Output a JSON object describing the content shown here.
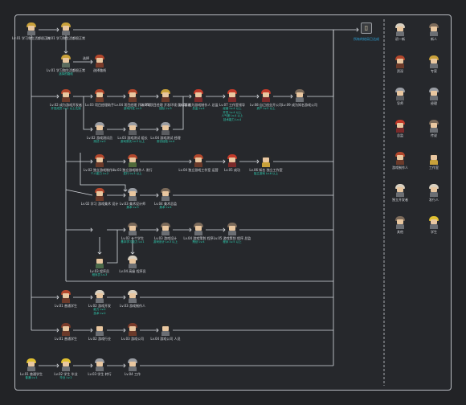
{
  "colors": {
    "line": "#d8dbe0",
    "accent": "#2fd0b3",
    "divider": "#c9cbd0",
    "end_label": "#2aa7e0"
  },
  "end_node": {
    "icon": "doorway-icon",
    "label": "所有的结局已达成"
  },
  "edge_note": "选择",
  "nodes": [
    {
      "id": "n1",
      "label": "Lv.01 学习和生活都很正常",
      "sub": "",
      "hair": "#c9a13a",
      "body": "#6b6e73"
    },
    {
      "id": "n2",
      "label": "Lv.01 学习和生活都很正常",
      "sub": "",
      "hair": "#c9a13a",
      "body": "#6b6e73"
    },
    {
      "id": "n3",
      "label": "Lv.01 学习和生活都很正常",
      "sub": "选择的路线",
      "hair": "#c9a13a",
      "body": "#5b6b5e"
    },
    {
      "id": "n4",
      "label": "选择路线",
      "sub": "",
      "hair": "#b3472c",
      "body": "#7a3b2a"
    },
    {
      "id": "n5",
      "label": "Lv.02 成为游戏开发者",
      "sub": "开发成员 Lv.2 以上达到",
      "hair": "#b3472c",
      "body": "#6b3a2a"
    },
    {
      "id": "n6",
      "label": "Lv.03 项目经理助手",
      "sub": "",
      "hair": "#b3472c",
      "body": "#6b3a2a"
    },
    {
      "id": "n7",
      "label": "Lv.04 项目经理 开发环境",
      "sub": "游戏开发 Lv.3",
      "hair": "#b3472c",
      "body": "#6b3a2a"
    },
    {
      "id": "n8",
      "label": "Lv.05 项目经理 开发环境 团队管理",
      "sub": "团队 Lv.3",
      "hair": "#c9a13a",
      "body": "#6b3a2a"
    },
    {
      "id": "n9",
      "label": "Lv.06 成为游戏制作人 总监",
      "sub": "总监 Lv.4",
      "hair": "#c23a2a",
      "body": "#7a2a2a"
    },
    {
      "id": "n10",
      "label": "Lv.07 工作室领导",
      "sub": "经营 Lv.4 以上\n开发 Lv.4 以上\n人气度 Lv.4 以上\n技术能力 Lv.4",
      "hair": "#c23a2a",
      "body": "#7a2a2a"
    },
    {
      "id": "n11",
      "label": "Lv.08 自己创业开公司",
      "sub": "资产 Lv.5 以上",
      "hair": "#c23a2a",
      "body": "#7a2a2a"
    },
    {
      "id": "n12",
      "label": "Lv.09 成为知名游戏公司",
      "sub": "",
      "hair": "#7b6a5a",
      "body": "#6b6e73"
    },
    {
      "id": "n13",
      "label": "Lv.02 游戏测试员",
      "sub": "测试 Lv.2",
      "hair": "#9a9da3",
      "body": "#5a5c60"
    },
    {
      "id": "n14",
      "label": "Lv.03 游戏测试 组长",
      "sub": "游戏测试 Lv.3 以上",
      "hair": "#9a9da3",
      "body": "#5a5c60"
    },
    {
      "id": "n15",
      "label": "Lv.04 游戏测试 经理",
      "sub": "测试经验 Lv.4",
      "hair": "#9a9da3",
      "body": "#5a5c60"
    },
    {
      "id": "n16",
      "label": "Lv.02 独立游戏制作人",
      "sub": "个人能力 Lv.2",
      "hair": "#b3472c",
      "body": "#6b3a2a"
    },
    {
      "id": "n17",
      "label": "Lv.03 独立游戏制作人 发行",
      "sub": "发行 Lv.3 以上",
      "hair": "#b3472c",
      "body": "#4f6a3a"
    },
    {
      "id": "n18",
      "label": "Lv.04 独立游戏工作室 运营",
      "sub": "",
      "hair": "#b3472c",
      "body": "#6b3a2a"
    },
    {
      "id": "n19",
      "label": "Lv.05 成功",
      "sub": "",
      "hair": "#c23a2a",
      "body": "#7a2a2a"
    },
    {
      "id": "n20",
      "label": "Lv.06 知名 独立工作室",
      "sub": "独立游戏 Lv.6 以上",
      "hair": "#2a2a2a",
      "body": "#c9a13a"
    },
    {
      "id": "n21",
      "label": "Lv.02 学习 游戏美术 设计",
      "sub": "",
      "hair": "#b3472c",
      "body": "#6b3a2a"
    },
    {
      "id": "n22",
      "label": "Lv.03 美术设计师",
      "sub": "美术 Lv.3",
      "hair": "#9a9da3",
      "body": "#6b6e73"
    },
    {
      "id": "n23",
      "label": "Lv.04 美术总监",
      "sub": "美术 Lv.4",
      "hair": "#7b6a5a",
      "body": "#6b6e73"
    },
    {
      "id": "n24",
      "label": "Lv.02 一个学生",
      "sub": "基本学习能力 Lv.1",
      "hair": "#7b6a5a",
      "body": "#6b6e73"
    },
    {
      "id": "n25",
      "label": "Lv.03 游戏设计",
      "sub": "游戏设计 Lv.3 以上",
      "hair": "#7b6a5a",
      "body": "#6b6e73"
    },
    {
      "id": "n26",
      "label": "Lv.04 游戏策划 程序",
      "sub": "策划 Lv.4",
      "hair": "#7b6a5a",
      "body": "#6b6e73"
    },
    {
      "id": "n27",
      "label": "Lv.05 游戏策划 程序 总监",
      "sub": "程序 Lv.5 以上",
      "hair": "#7b6a5a",
      "body": "#6b6e73"
    },
    {
      "id": "n28",
      "label": "Lv.03 程序员",
      "sub": "程序员 Lv.3",
      "hair": "#2a2a2a",
      "body": "#4a6a4a"
    },
    {
      "id": "n29",
      "label": "Lv.04 高级 程序员",
      "sub": "",
      "hair": "#d9d0c0",
      "body": "#6b6e73"
    },
    {
      "id": "n30",
      "label": "Lv.01 普通学生",
      "sub": "",
      "hair": "#b3472c",
      "body": "#6b3a2a"
    },
    {
      "id": "n31",
      "label": "Lv.02 游戏开发",
      "sub": "能力 Lv.2\n技术 Lv.2",
      "hair": "#d9d0c0",
      "body": "#6b6e73"
    },
    {
      "id": "n32",
      "label": "Lv.03 游戏制作人",
      "sub": "",
      "hair": "#d9d0c0",
      "body": "#6b6e73"
    },
    {
      "id": "n33",
      "label": "Lv.01 普通学生",
      "sub": "",
      "hair": "#7a3b2a",
      "body": "#6b3a2a"
    },
    {
      "id": "n34",
      "label": "Lv.02 游戏行业",
      "sub": "",
      "hair": "#2a2a2a",
      "body": "#6b6e73"
    },
    {
      "id": "n35",
      "label": "Lv.03 游戏公司",
      "sub": "",
      "hair": "#7a3b2a",
      "body": "#6b3a2a"
    },
    {
      "id": "n36",
      "label": "Lv.04 游戏公司 人员",
      "sub": "",
      "hair": "#2a2a2a",
      "body": "#6b6e73"
    },
    {
      "id": "n37",
      "label": "Lv.01 普通学生",
      "sub": "普通 Lv.1",
      "hair": "#e0c030",
      "body": "#6b6e73"
    },
    {
      "id": "n38",
      "label": "Lv.02 学生 毕业",
      "sub": "毕业 Lv.2",
      "hair": "#e0c030",
      "body": "#6b6e73"
    },
    {
      "id": "n39",
      "label": "Lv.03 学生 转行",
      "sub": "",
      "hair": "#9a9da3",
      "body": "#6b6e73"
    },
    {
      "id": "n40",
      "label": "Lv.04 工作",
      "sub": "",
      "hair": "#9a9da3",
      "body": "#6b6e73"
    }
  ],
  "legend": [
    {
      "label": "初一新",
      "hair": "#d9d0c0",
      "body": "#6b6e73"
    },
    {
      "label": "新人",
      "hair": "#7b6a5a",
      "body": "#6b6e73"
    },
    {
      "label": "资深",
      "hair": "#b3472c",
      "body": "#6b3a2a"
    },
    {
      "label": "专家",
      "hair": "#c9a13a",
      "body": "#6b6e73"
    },
    {
      "label": "导师",
      "hair": "#9a9da3",
      "body": "#5a5c60"
    },
    {
      "label": "经理",
      "hair": "#9a9da3",
      "body": "#6b6e73"
    },
    {
      "label": "总监",
      "hair": "#c23a2a",
      "body": "#7a2a2a"
    },
    {
      "label": "传说",
      "hair": "#7b6a5a",
      "body": "#6b6e73"
    },
    {
      "label": "游戏制作人",
      "hair": "#b3472c",
      "body": "#6b3a2a"
    },
    {
      "label": "工作室",
      "hair": "#2a2a2a",
      "body": "#c9a13a"
    },
    {
      "label": "独立开发者",
      "hair": "#d9d0c0",
      "body": "#6b6e73"
    },
    {
      "label": "发行人",
      "hair": "#d9d0c0",
      "body": "#6b6e73"
    },
    {
      "label": "其他",
      "hair": "#7b6a5a",
      "body": "#6b6e73"
    },
    {
      "label": "学生",
      "hair": "#e0c030",
      "body": "#6b6e73"
    }
  ]
}
